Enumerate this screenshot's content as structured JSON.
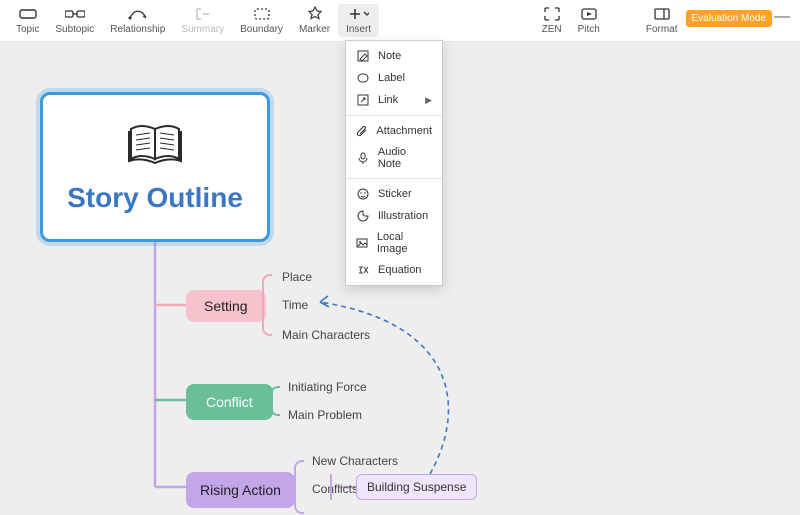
{
  "toolbar": {
    "topic": "Topic",
    "subtopic": "Subtopic",
    "relationship": "Relationship",
    "summary": "Summary",
    "boundary": "Boundary",
    "marker": "Marker",
    "insert": "Insert",
    "zen": "ZEN",
    "pitch": "Pitch",
    "format": "Format",
    "evaluation": "Evaluation Mode"
  },
  "dropdown": {
    "note": "Note",
    "label": "Label",
    "link": "Link",
    "attachment": "Attachment",
    "audio": "Audio Note",
    "sticker": "Sticker",
    "illustration": "Illustration",
    "localimage": "Local Image",
    "equation": "Equation"
  },
  "mindmap": {
    "root": "Story Outline",
    "setting": {
      "label": "Setting",
      "subs": [
        "Place",
        "Time",
        "Main Characters"
      ]
    },
    "conflict": {
      "label": "Conflict",
      "subs": [
        "Initiating Force",
        "Main Problem"
      ]
    },
    "rising": {
      "label": "Rising Action",
      "subs": [
        "New Characters",
        "Conflicts"
      ],
      "child": "Building Suspense"
    }
  }
}
